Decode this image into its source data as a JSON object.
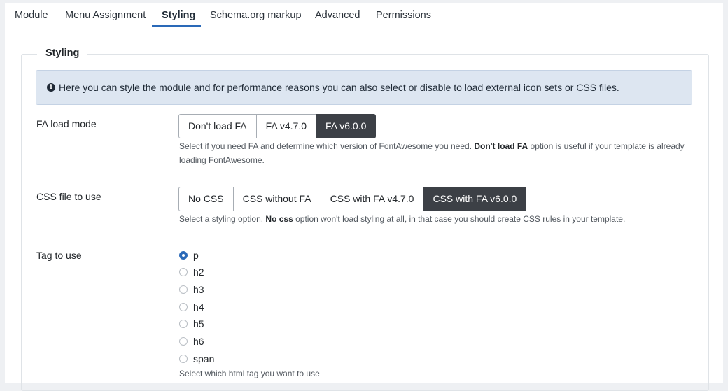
{
  "tabs": [
    {
      "label": "Module"
    },
    {
      "label": "Menu Assignment"
    },
    {
      "label": "Styling"
    },
    {
      "label": "Schema.org markup"
    },
    {
      "label": "Advanced"
    },
    {
      "label": "Permissions"
    }
  ],
  "active_tab": "Styling",
  "fieldset": {
    "legend": "Styling"
  },
  "alert": {
    "icon": "info-circle-icon",
    "text": "Here you can style the module and for performance reasons you can also select or disable to load external icon sets or CSS files."
  },
  "fa_load_mode": {
    "label": "FA load mode",
    "options": [
      "Don't load FA",
      "FA v4.7.0",
      "FA v6.0.0"
    ],
    "selected": "FA v6.0.0",
    "desc_part1": "Select if you need FA and determine which version of FontAwesome you need. ",
    "desc_bold": "Don't load FA",
    "desc_part2": " option is useful if your template is already",
    "desc_line2": "loading FontAwesome."
  },
  "css_file": {
    "label": "CSS file to use",
    "options": [
      "No CSS",
      "CSS without FA",
      "CSS with FA v4.7.0",
      "CSS with FA v6.0.0"
    ],
    "selected": "CSS with FA v6.0.0",
    "desc_part1": "Select a styling option. ",
    "desc_bold": "No css",
    "desc_part2": " option won't load styling at all, in that case you should create CSS rules in your template."
  },
  "tag_to_use": {
    "label": "Tag to use",
    "options": [
      "p",
      "h2",
      "h3",
      "h4",
      "h5",
      "h6",
      "span"
    ],
    "selected": "p",
    "desc": "Select which html tag you want to use"
  },
  "colors": {
    "accent": "#2a69b8",
    "active_button": "#3c4046",
    "alert_bg": "#dde6f1"
  }
}
